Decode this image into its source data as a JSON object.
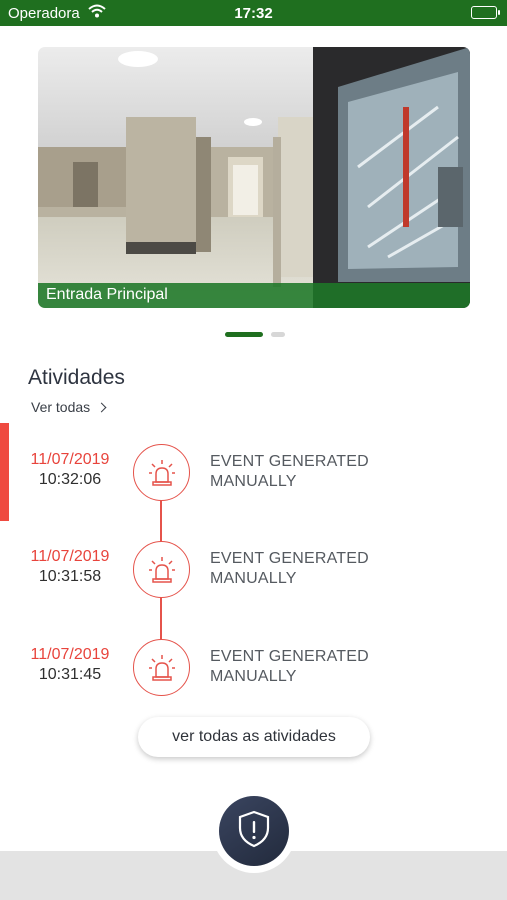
{
  "status_bar": {
    "carrier": "Operadora",
    "time": "17:32"
  },
  "camera": {
    "label": "Entrada Principal"
  },
  "activities_section": {
    "title": "Atividades",
    "see_all": "Ver todas"
  },
  "activities": [
    {
      "date": "11/07/2019",
      "time": "10:32:06",
      "line1": "EVENT GENERATED",
      "line2": "MANUALLY",
      "icon": "siren-icon"
    },
    {
      "date": "11/07/2019",
      "time": "10:31:58",
      "line1": "EVENT GENERATED",
      "line2": "MANUALLY",
      "icon": "siren-icon"
    },
    {
      "date": "11/07/2019",
      "time": "10:31:45",
      "line1": "EVENT GENERATED",
      "line2": "MANUALLY",
      "icon": "siren-icon"
    }
  ],
  "all_activities_button": "ver todas as atividades",
  "colors": {
    "brand_green": "#1f6f1f",
    "alert_red": "#e8443c",
    "fab_navy": "#2b3349"
  }
}
